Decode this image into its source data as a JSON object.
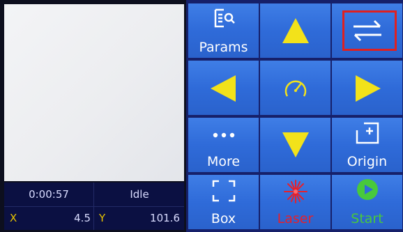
{
  "status": {
    "time": "0:00:57",
    "state": "Idle",
    "x_label": "X",
    "x_value": "4.5",
    "y_label": "Y",
    "y_value": "101.6"
  },
  "buttons": {
    "params": "Params",
    "more": "More",
    "origin": "Origin",
    "box": "Box",
    "laser": "Laser",
    "start": "Start"
  },
  "icons": {
    "params": "params-search-icon",
    "up": "arrow-up-icon",
    "swap": "swap-arrows-icon",
    "left": "arrow-left-icon",
    "speed": "speedometer-icon",
    "right": "arrow-right-icon",
    "more": "more-dots-icon",
    "down": "arrow-down-icon",
    "origin": "origin-crosshair-icon",
    "box": "frame-box-icon",
    "laser": "laser-burst-icon",
    "start": "play-icon"
  },
  "colors": {
    "button_blue": "#3478e0",
    "arrow_yellow": "#f2e21a",
    "laser_red": "#e8202a",
    "start_green": "#48c93c",
    "selection_red": "#e02020",
    "status_bg": "#0b1042"
  }
}
